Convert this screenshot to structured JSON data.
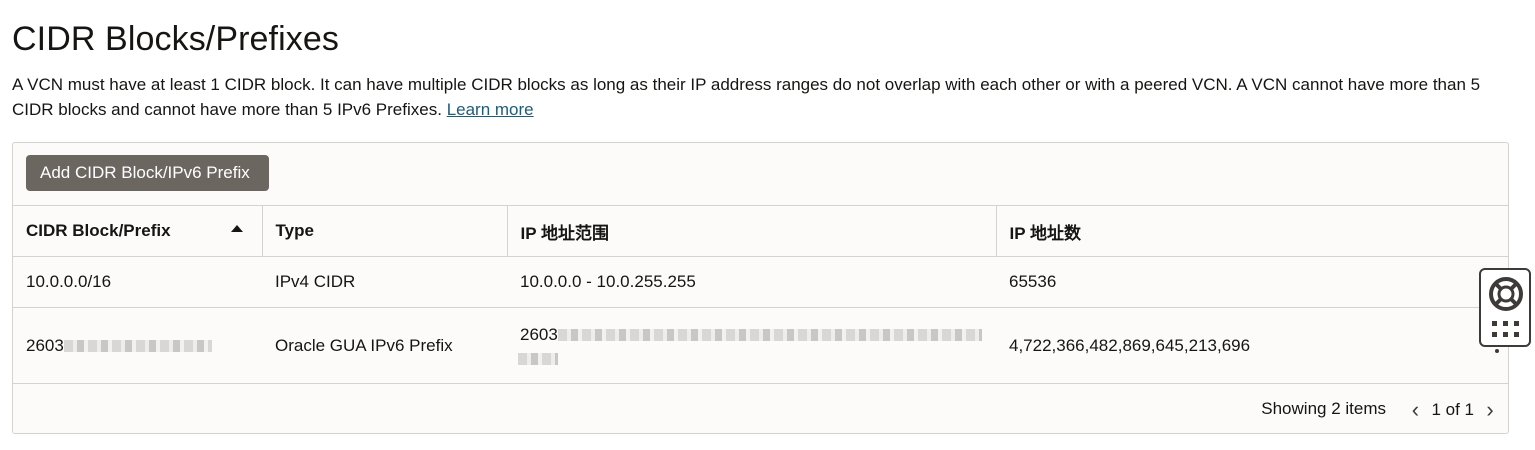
{
  "page": {
    "title": "CIDR Blocks/Prefixes",
    "description": "A VCN must have at least 1 CIDR block. It can have multiple CIDR blocks as long as their IP address ranges do not overlap with each other or with a peered VCN. A VCN cannot have more than 5 CIDR blocks and cannot have more than 5 IPv6 Prefixes.",
    "learn_more": "Learn more"
  },
  "toolbar": {
    "add_label": "Add CIDR Block/IPv6 Prefix"
  },
  "table": {
    "columns": [
      "CIDR Block/Prefix",
      "Type",
      "IP 地址范围",
      "IP 地址数"
    ],
    "sort_direction": "ascending",
    "rows": [
      {
        "cidr": "10.0.0.0/16",
        "type": "IPv4 CIDR",
        "range": "10.0.0.0 - 10.0.255.255",
        "count": "65536"
      },
      {
        "cidr": "2603",
        "type": "Oracle GUA IPv6 Prefix",
        "range": "2603",
        "count": "4,722,366,482,869,645,213,696"
      }
    ]
  },
  "footer": {
    "showing": "Showing 2 items",
    "page": "1 of 1"
  },
  "icons": {
    "sort": "sort-ascending-icon",
    "prev": "chevron-left-icon",
    "next": "chevron-right-icon",
    "help": "lifebuoy-icon",
    "apps": "grid-icon"
  },
  "colors": {
    "button": "#6c6661",
    "link": "#1f5c7a",
    "border": "#d5d2ce"
  }
}
